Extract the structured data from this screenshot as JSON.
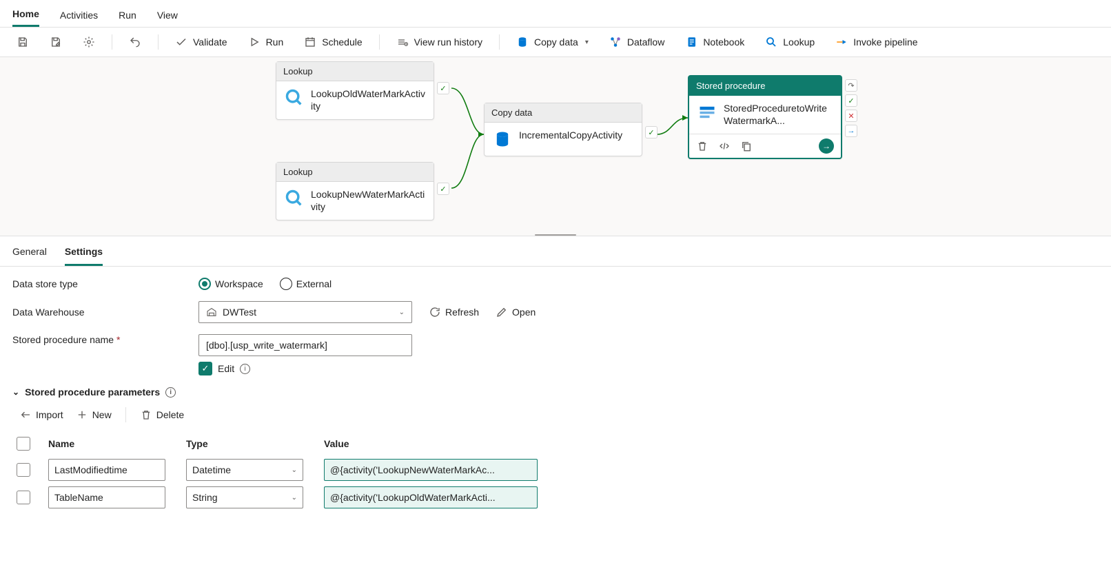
{
  "ribbon": {
    "tabs": [
      "Home",
      "Activities",
      "Run",
      "View"
    ],
    "active": "Home"
  },
  "toolbar": {
    "validate": "Validate",
    "run": "Run",
    "schedule": "Schedule",
    "view_history": "View run history",
    "copy_data": "Copy data",
    "dataflow": "Dataflow",
    "notebook": "Notebook",
    "lookup": "Lookup",
    "invoke_pipeline": "Invoke pipeline"
  },
  "activities": {
    "lookup1": {
      "type": "Lookup",
      "name": "LookupOldWaterMarkActivity"
    },
    "lookup2": {
      "type": "Lookup",
      "name": "LookupNewWaterMarkActivity"
    },
    "copy": {
      "type": "Copy data",
      "name": "IncrementalCopyActivity"
    },
    "sproc": {
      "type": "Stored procedure",
      "name": "StoredProceduretoWriteWatermarkA..."
    }
  },
  "detail_tabs": {
    "items": [
      "General",
      "Settings"
    ],
    "active": "Settings"
  },
  "settings": {
    "labels": {
      "data_store_type": "Data store type",
      "data_warehouse": "Data Warehouse",
      "sproc_name": "Stored procedure name",
      "edit": "Edit",
      "sproc_params": "Stored procedure parameters",
      "refresh": "Refresh",
      "open": "Open"
    },
    "data_store_type": {
      "options": [
        "Workspace",
        "External"
      ],
      "selected": "Workspace"
    },
    "data_warehouse": "DWTest",
    "sproc_name": "[dbo].[usp_write_watermark]",
    "edit_checked": true,
    "param_toolbar": {
      "import": "Import",
      "new": "New",
      "delete": "Delete"
    },
    "table": {
      "headers": {
        "name": "Name",
        "type": "Type",
        "value": "Value"
      },
      "rows": [
        {
          "name": "LastModifiedtime",
          "type": "Datetime",
          "value": "@{activity('LookupNewWaterMarkAc..."
        },
        {
          "name": "TableName",
          "type": "String",
          "value": "@{activity('LookupOldWaterMarkActi..."
        }
      ]
    }
  }
}
